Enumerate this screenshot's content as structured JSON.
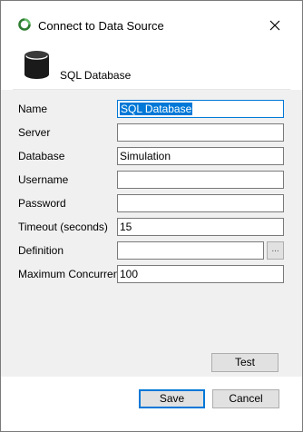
{
  "window": {
    "title": "Connect to Data Source",
    "close_icon": "close-icon",
    "app_icon": "circular-arrow-icon"
  },
  "header": {
    "icon": "database-icon",
    "label": "SQL Database"
  },
  "form": {
    "name": {
      "label": "Name",
      "value": "SQL Database"
    },
    "server": {
      "label": "Server",
      "value": ""
    },
    "database": {
      "label": "Database",
      "value": "Simulation"
    },
    "username": {
      "label": "Username",
      "value": ""
    },
    "password": {
      "label": "Password",
      "value": ""
    },
    "timeout": {
      "label": "Timeout (seconds)",
      "value": "15"
    },
    "definition": {
      "label": "Definition",
      "value": "",
      "browse_label": "..."
    },
    "max_concurrent": {
      "label": "Maximum Concurrent",
      "value": "100"
    }
  },
  "buttons": {
    "test": "Test",
    "save": "Save",
    "cancel": "Cancel"
  },
  "colors": {
    "accent": "#0078d7",
    "panel_bg": "#f0f0f0",
    "button_bg": "#e1e1e1"
  }
}
